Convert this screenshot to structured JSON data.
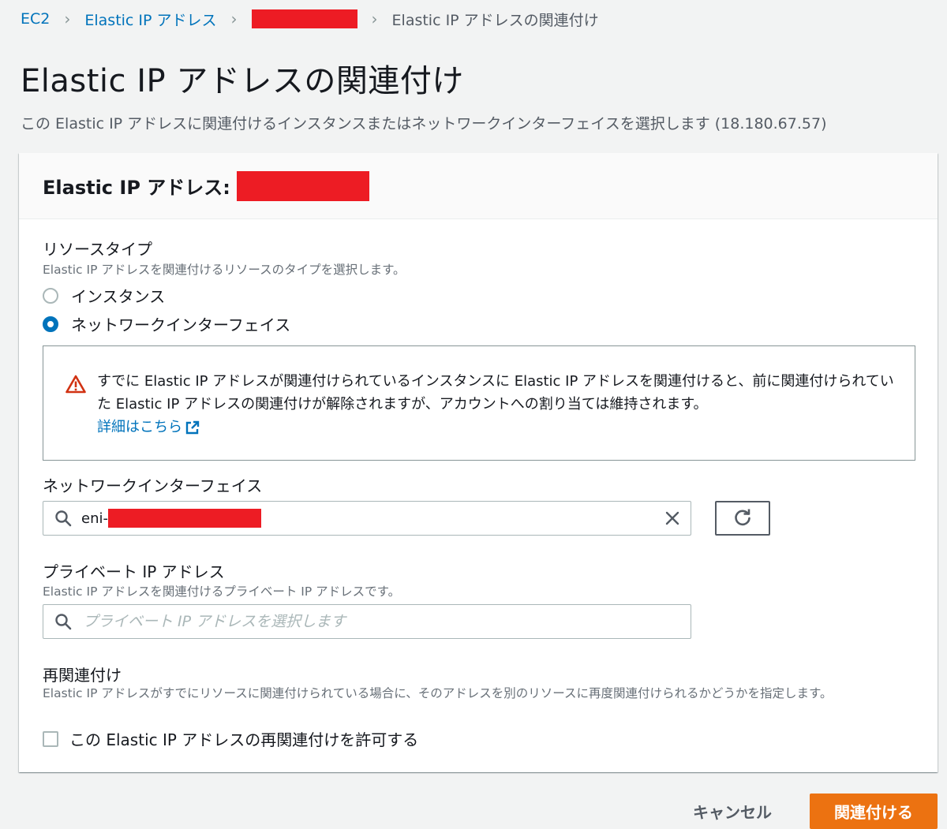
{
  "breadcrumb": {
    "items": [
      {
        "label": "EC2"
      },
      {
        "label": "Elastic IP アドレス"
      }
    ],
    "current": "Elastic IP アドレスの関連付け"
  },
  "page": {
    "title": "Elastic IP アドレスの関連付け",
    "description": "この Elastic IP アドレスに関連付けるインスタンスまたはネットワークインターフェイスを選択します (18.180.67.57)"
  },
  "panel": {
    "header_label": "Elastic IP アドレス:"
  },
  "resource_type": {
    "label": "リソースタイプ",
    "description": "Elastic IP アドレスを関連付けるリソースのタイプを選択します。",
    "options": [
      {
        "label": "インスタンス",
        "selected": false
      },
      {
        "label": "ネットワークインターフェイス",
        "selected": true
      }
    ]
  },
  "alert": {
    "text": "すでに Elastic IP アドレスが関連付けられているインスタンスに Elastic IP アドレスを関連付けると、前に関連付けられていた Elastic IP アドレスの関連付けが解除されますが、アカウントへの割り当ては維持されます。",
    "link_label": "詳細はこちら",
    "color": "#d13212"
  },
  "network_interface": {
    "label": "ネットワークインターフェイス",
    "value_prefix": "eni-"
  },
  "private_ip": {
    "label": "プライベート IP アドレス",
    "description": "Elastic IP アドレスを関連付けるプライベート IP アドレスです。",
    "placeholder": "プライベート IP アドレスを選択します"
  },
  "reassociation": {
    "label": "再関連付け",
    "description": "Elastic IP アドレスがすでにリソースに関連付けられている場合に、そのアドレスを別のリソースに再度関連付けられるかどうかを指定します。",
    "checkbox_label": "この Elastic IP アドレスの再関連付けを許可する",
    "checked": false
  },
  "actions": {
    "cancel_label": "キャンセル",
    "associate_label": "関連付ける",
    "primary_color": "#ec7211"
  },
  "icons": {
    "search": "search-icon",
    "clear": "close-icon",
    "refresh": "refresh-icon",
    "warning": "warning-icon",
    "external": "external-link-icon"
  }
}
